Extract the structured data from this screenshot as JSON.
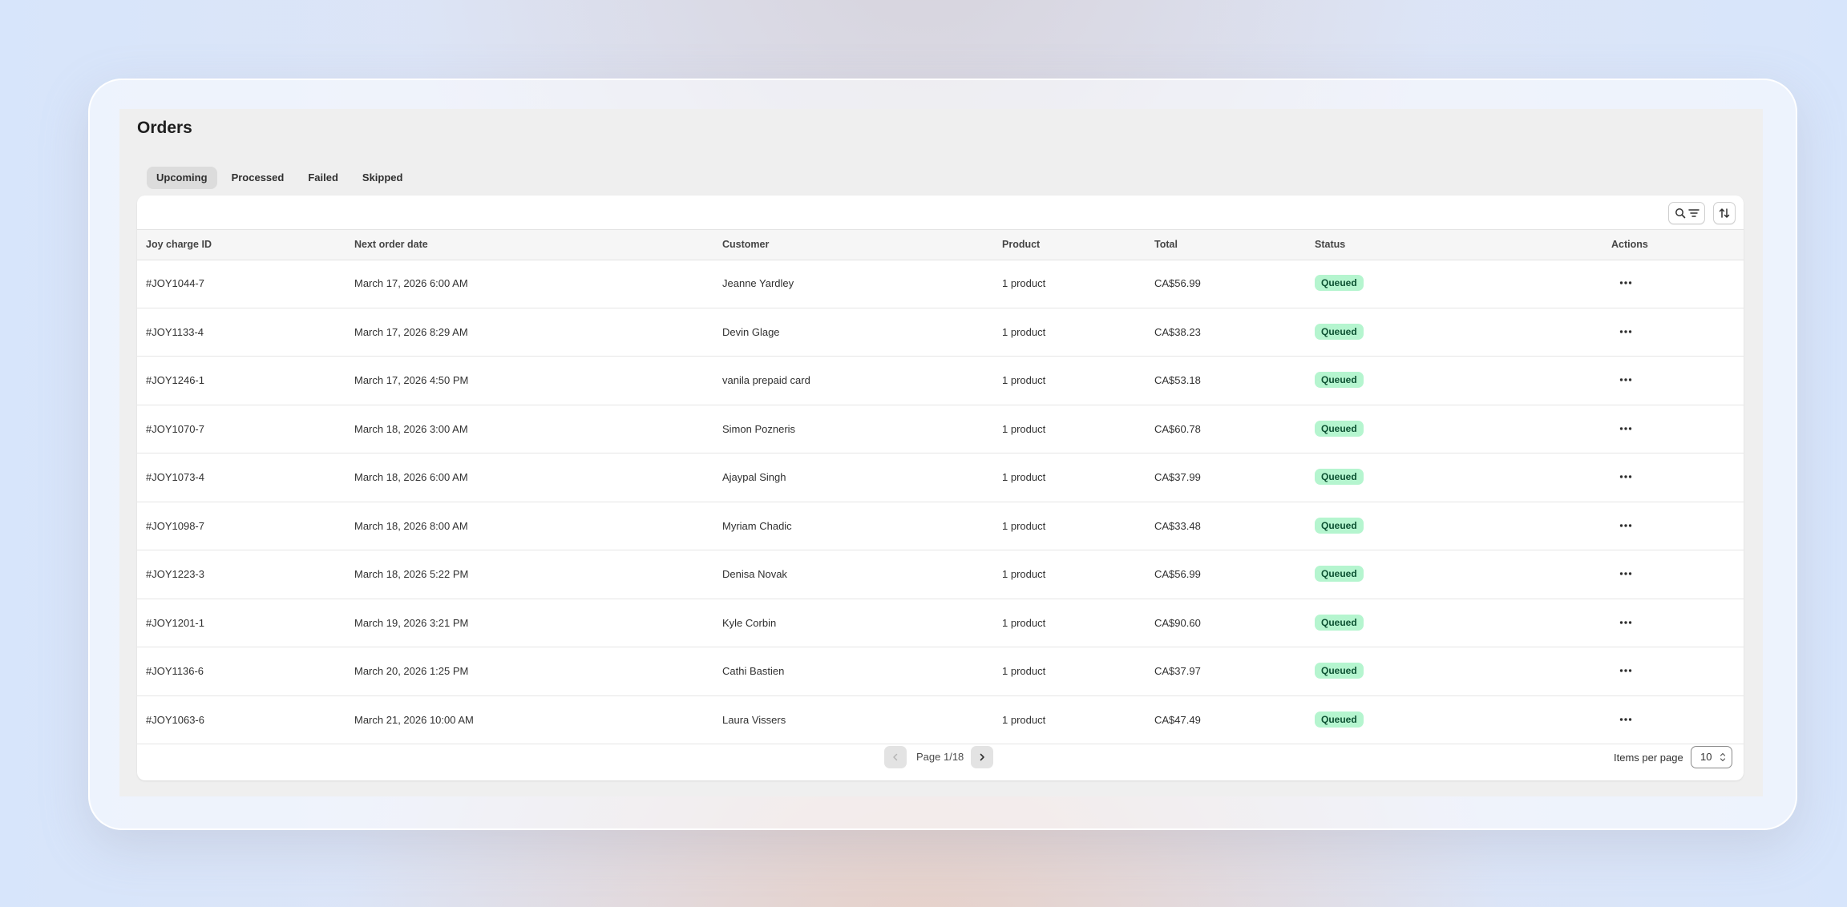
{
  "page": {
    "title": "Orders"
  },
  "tabs": [
    {
      "label": "Upcoming",
      "active": true
    },
    {
      "label": "Processed",
      "active": false
    },
    {
      "label": "Failed",
      "active": false
    },
    {
      "label": "Skipped",
      "active": false
    }
  ],
  "toolbar": {
    "search_filter_icon": "search-filter-icon",
    "sort_icon": "sort-icon"
  },
  "table": {
    "headers": [
      "Joy charge ID",
      "Next order date",
      "Customer",
      "Product",
      "Total",
      "Status",
      "Actions"
    ],
    "rows": [
      {
        "id": "#JOY1044-7",
        "date": "March 17, 2026 6:00 AM",
        "customer": "Jeanne Yardley",
        "product": "1 product",
        "total": "CA$56.99",
        "status": "Queued"
      },
      {
        "id": "#JOY1133-4",
        "date": "March 17, 2026 8:29 AM",
        "customer": "Devin Glage",
        "product": "1 product",
        "total": "CA$38.23",
        "status": "Queued"
      },
      {
        "id": "#JOY1246-1",
        "date": "March 17, 2026 4:50 PM",
        "customer": "vanila prepaid card",
        "product": "1 product",
        "total": "CA$53.18",
        "status": "Queued"
      },
      {
        "id": "#JOY1070-7",
        "date": "March 18, 2026 3:00 AM",
        "customer": "Simon Pozneris",
        "product": "1 product",
        "total": "CA$60.78",
        "status": "Queued"
      },
      {
        "id": "#JOY1073-4",
        "date": "March 18, 2026 6:00 AM",
        "customer": "Ajaypal Singh",
        "product": "1 product",
        "total": "CA$37.99",
        "status": "Queued"
      },
      {
        "id": "#JOY1098-7",
        "date": "March 18, 2026 8:00 AM",
        "customer": "Myriam Chadic",
        "product": "1 product",
        "total": "CA$33.48",
        "status": "Queued"
      },
      {
        "id": "#JOY1223-3",
        "date": "March 18, 2026 5:22 PM",
        "customer": "Denisa Novak",
        "product": "1 product",
        "total": "CA$56.99",
        "status": "Queued"
      },
      {
        "id": "#JOY1201-1",
        "date": "March 19, 2026 3:21 PM",
        "customer": "Kyle Corbin",
        "product": "1 product",
        "total": "CA$90.60",
        "status": "Queued"
      },
      {
        "id": "#JOY1136-6",
        "date": "March 20, 2026 1:25 PM",
        "customer": "Cathi Bastien",
        "product": "1 product",
        "total": "CA$37.97",
        "status": "Queued"
      },
      {
        "id": "#JOY1063-6",
        "date": "March 21, 2026 10:00 AM",
        "customer": "Laura Vissers",
        "product": "1 product",
        "total": "CA$47.49",
        "status": "Queued"
      }
    ]
  },
  "pagination": {
    "label": "Page 1/18",
    "items_per_page_label": "Items per page",
    "items_per_page_value": "10"
  },
  "colors": {
    "badge_bg": "#b5f5cf",
    "badge_text": "#0c5132",
    "panel_bg": "#efefef"
  }
}
